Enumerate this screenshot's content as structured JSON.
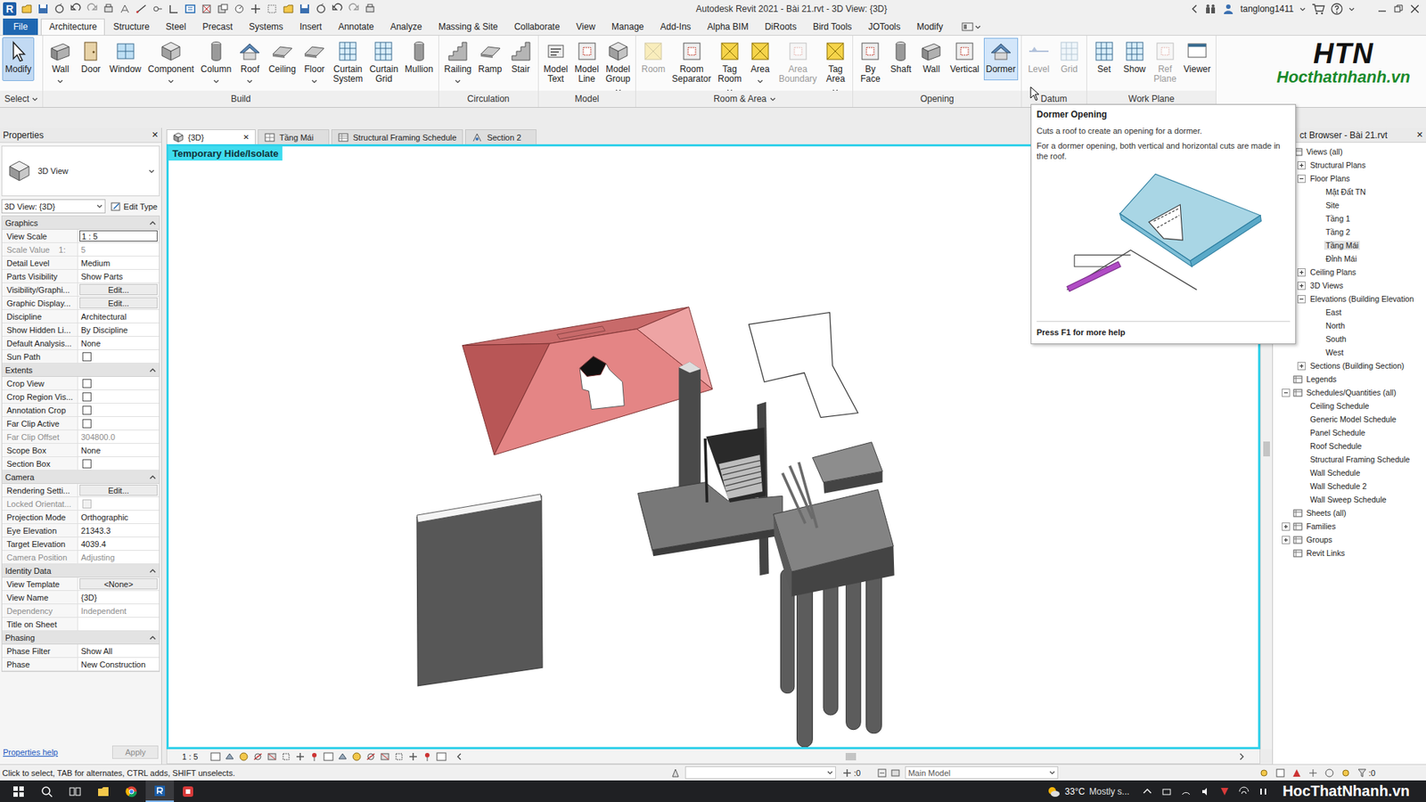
{
  "window": {
    "app_logo": "R",
    "title": "Autodesk Revit 2021 - Bài 21.rvt - 3D View: {3D}",
    "user": "tanglong1411"
  },
  "ribbon": {
    "tabs": [
      {
        "label": "File",
        "kind": "menu",
        "selected": false
      },
      {
        "label": "Architecture",
        "kind": "tab",
        "selected": true
      },
      {
        "label": "Structure",
        "kind": "tab",
        "selected": false
      },
      {
        "label": "Steel",
        "kind": "tab",
        "selected": false
      },
      {
        "label": "Precast",
        "kind": "tab",
        "selected": false
      },
      {
        "label": "Systems",
        "kind": "tab",
        "selected": false
      },
      {
        "label": "Insert",
        "kind": "tab",
        "selected": false
      },
      {
        "label": "Annotate",
        "kind": "tab",
        "selected": false
      },
      {
        "label": "Analyze",
        "kind": "tab",
        "selected": false
      },
      {
        "label": "Massing & Site",
        "kind": "tab",
        "selected": false
      },
      {
        "label": "Collaborate",
        "kind": "tab",
        "selected": false
      },
      {
        "label": "View",
        "kind": "tab",
        "selected": false
      },
      {
        "label": "Manage",
        "kind": "tab",
        "selected": false
      },
      {
        "label": "Add-Ins",
        "kind": "tab",
        "selected": false
      },
      {
        "label": "Alpha BIM",
        "kind": "tab",
        "selected": false
      },
      {
        "label": "DiRoots",
        "kind": "tab",
        "selected": false
      },
      {
        "label": "Bird Tools",
        "kind": "tab",
        "selected": false
      },
      {
        "label": "JOTools",
        "kind": "tab",
        "selected": false
      },
      {
        "label": "Modify",
        "kind": "tab",
        "selected": false
      }
    ],
    "panels": [
      {
        "title": "Select",
        "dropdown": true,
        "buttons": [
          {
            "label": "Modify",
            "selected": true,
            "hovered": false,
            "disabled": false,
            "dropdown": false
          }
        ]
      },
      {
        "title": "Build",
        "dropdown": false,
        "buttons": [
          {
            "label": "Wall",
            "selected": false,
            "hovered": false,
            "disabled": false,
            "dropdown": true
          },
          {
            "label": "Door",
            "selected": false,
            "hovered": false,
            "disabled": false,
            "dropdown": false
          },
          {
            "label": "Window",
            "selected": false,
            "hovered": false,
            "disabled": false,
            "dropdown": false
          },
          {
            "label": "Component",
            "selected": false,
            "hovered": false,
            "disabled": false,
            "dropdown": true
          },
          {
            "label": "Column",
            "selected": false,
            "hovered": false,
            "disabled": false,
            "dropdown": true
          },
          {
            "label": "Roof",
            "selected": false,
            "hovered": false,
            "disabled": false,
            "dropdown": true
          },
          {
            "label": "Ceiling",
            "selected": false,
            "hovered": false,
            "disabled": false,
            "dropdown": false
          },
          {
            "label": "Floor",
            "selected": false,
            "hovered": false,
            "disabled": false,
            "dropdown": true
          },
          {
            "label": "Curtain System",
            "selected": false,
            "hovered": false,
            "disabled": false,
            "dropdown": false
          },
          {
            "label": "Curtain Grid",
            "selected": false,
            "hovered": false,
            "disabled": false,
            "dropdown": false
          },
          {
            "label": "Mullion",
            "selected": false,
            "hovered": false,
            "disabled": false,
            "dropdown": false
          }
        ]
      },
      {
        "title": "Circulation",
        "dropdown": false,
        "buttons": [
          {
            "label": "Railing",
            "selected": false,
            "hovered": false,
            "disabled": false,
            "dropdown": true
          },
          {
            "label": "Ramp",
            "selected": false,
            "hovered": false,
            "disabled": false,
            "dropdown": false
          },
          {
            "label": "Stair",
            "selected": false,
            "hovered": false,
            "disabled": false,
            "dropdown": false
          }
        ]
      },
      {
        "title": "Model",
        "dropdown": false,
        "buttons": [
          {
            "label": "Model Text",
            "selected": false,
            "hovered": false,
            "disabled": false,
            "dropdown": false
          },
          {
            "label": "Model Line",
            "selected": false,
            "hovered": false,
            "disabled": false,
            "dropdown": false
          },
          {
            "label": "Model Group",
            "selected": false,
            "hovered": false,
            "disabled": false,
            "dropdown": true
          }
        ]
      },
      {
        "title": "Room & Area",
        "dropdown": true,
        "buttons": [
          {
            "label": "Room",
            "selected": false,
            "hovered": false,
            "disabled": true,
            "dropdown": false
          },
          {
            "label": "Room Separator",
            "selected": false,
            "hovered": false,
            "disabled": false,
            "dropdown": false
          },
          {
            "label": "Tag Room",
            "selected": false,
            "hovered": false,
            "disabled": false,
            "dropdown": true
          },
          {
            "label": "Area",
            "selected": false,
            "hovered": false,
            "disabled": false,
            "dropdown": true
          },
          {
            "label": "Area Boundary",
            "selected": false,
            "hovered": false,
            "disabled": true,
            "dropdown": false
          },
          {
            "label": "Tag Area",
            "selected": false,
            "hovered": false,
            "disabled": false,
            "dropdown": true
          }
        ]
      },
      {
        "title": "Opening",
        "dropdown": false,
        "buttons": [
          {
            "label": "By Face",
            "selected": false,
            "hovered": false,
            "disabled": false,
            "dropdown": false
          },
          {
            "label": "Shaft",
            "selected": false,
            "hovered": false,
            "disabled": false,
            "dropdown": false
          },
          {
            "label": "Wall",
            "selected": false,
            "hovered": false,
            "disabled": false,
            "dropdown": false
          },
          {
            "label": "Vertical",
            "selected": false,
            "hovered": false,
            "disabled": false,
            "dropdown": false
          },
          {
            "label": "Dormer",
            "selected": false,
            "hovered": true,
            "disabled": false,
            "dropdown": false
          }
        ]
      },
      {
        "title": "Datum",
        "dropdown": false,
        "buttons": [
          {
            "label": "Level",
            "selected": false,
            "hovered": false,
            "disabled": true,
            "dropdown": false
          },
          {
            "label": "Grid",
            "selected": false,
            "hovered": false,
            "disabled": true,
            "dropdown": false
          }
        ]
      },
      {
        "title": "Work Plane",
        "dropdown": false,
        "buttons": [
          {
            "label": "Set",
            "selected": false,
            "hovered": false,
            "disabled": false,
            "dropdown": false
          },
          {
            "label": "Show",
            "selected": false,
            "hovered": false,
            "disabled": false,
            "dropdown": false
          },
          {
            "label": "Ref Plane",
            "selected": false,
            "hovered": false,
            "disabled": true,
            "dropdown": false
          },
          {
            "label": "Viewer",
            "selected": false,
            "hovered": false,
            "disabled": false,
            "dropdown": false
          }
        ]
      }
    ]
  },
  "logo": {
    "mark": "HTN",
    "site": "Hocthatnhanh.vn"
  },
  "tooltip": {
    "title": "Dormer Opening",
    "lines": [
      "Cuts a roof to create an opening for a dormer.",
      "For a dormer opening, both vertical and horizontal cuts are made in the roof."
    ],
    "footer": "Press F1 for more help"
  },
  "properties": {
    "title": "Properties",
    "close": "✕",
    "type": "3D View",
    "selector": "3D View: {3D}",
    "edit_type": "Edit Type",
    "sections": [
      {
        "title": "Graphics",
        "expanded": true,
        "rows": [
          {
            "label": "View Scale",
            "value": "1 : 5",
            "kind": "field",
            "disabled": false
          },
          {
            "label": "Scale Value    1:",
            "value": "5",
            "kind": "text",
            "disabled": true
          },
          {
            "label": "Detail Level",
            "value": "Medium",
            "kind": "text",
            "disabled": false
          },
          {
            "label": "Parts Visibility",
            "value": "Show Parts",
            "kind": "text",
            "disabled": false
          },
          {
            "label": "Visibility/Graphi...",
            "value": "Edit...",
            "kind": "button",
            "disabled": false
          },
          {
            "label": "Graphic Display...",
            "value": "Edit...",
            "kind": "button",
            "disabled": false
          },
          {
            "label": "Discipline",
            "value": "Architectural",
            "kind": "text",
            "disabled": false
          },
          {
            "label": "Show Hidden Li...",
            "value": "By Discipline",
            "kind": "text",
            "disabled": false
          },
          {
            "label": "Default Analysis...",
            "value": "None",
            "kind": "text",
            "disabled": false
          },
          {
            "label": "Sun Path",
            "kind": "checkbox",
            "checked": false,
            "disabled": false
          }
        ]
      },
      {
        "title": "Extents",
        "expanded": true,
        "rows": [
          {
            "label": "Crop View",
            "kind": "checkbox",
            "checked": false,
            "disabled": false
          },
          {
            "label": "Crop Region Vis...",
            "kind": "checkbox",
            "checked": false,
            "disabled": false
          },
          {
            "label": "Annotation Crop",
            "kind": "checkbox",
            "checked": false,
            "disabled": false
          },
          {
            "label": "Far Clip Active",
            "kind": "checkbox",
            "checked": false,
            "disabled": false
          },
          {
            "label": "Far Clip Offset",
            "value": "304800.0",
            "kind": "text",
            "disabled": true
          },
          {
            "label": "Scope Box",
            "value": "None",
            "kind": "text",
            "disabled": false
          },
          {
            "label": "Section Box",
            "kind": "checkbox",
            "checked": false,
            "disabled": false
          }
        ]
      },
      {
        "title": "Camera",
        "expanded": true,
        "rows": [
          {
            "label": "Rendering Setti...",
            "value": "Edit...",
            "kind": "button",
            "disabled": false
          },
          {
            "label": "Locked Orientat...",
            "kind": "checkbox",
            "checked": false,
            "disabled": true
          },
          {
            "label": "Projection Mode",
            "value": "Orthographic",
            "kind": "text",
            "disabled": false
          },
          {
            "label": "Eye Elevation",
            "value": "21343.3",
            "kind": "text",
            "disabled": false
          },
          {
            "label": "Target Elevation",
            "value": "4039.4",
            "kind": "text",
            "disabled": false
          },
          {
            "label": "Camera Position",
            "value": "Adjusting",
            "kind": "text",
            "disabled": true
          }
        ]
      },
      {
        "title": "Identity Data",
        "expanded": true,
        "rows": [
          {
            "label": "View Template",
            "value": "<None>",
            "kind": "button",
            "disabled": false
          },
          {
            "label": "View Name",
            "value": "{3D}",
            "kind": "text",
            "disabled": false
          },
          {
            "label": "Dependency",
            "value": "Independent",
            "kind": "text",
            "disabled": true
          },
          {
            "label": "Title on Sheet",
            "value": "",
            "kind": "text",
            "disabled": false
          }
        ]
      },
      {
        "title": "Phasing",
        "expanded": true,
        "rows": [
          {
            "label": "Phase Filter",
            "value": "Show All",
            "kind": "text",
            "disabled": false
          },
          {
            "label": "Phase",
            "value": "New Construction",
            "kind": "text",
            "disabled": false
          }
        ]
      }
    ],
    "help": "Properties help",
    "apply": "Apply"
  },
  "view_tabs": [
    {
      "label": "{3D}",
      "selected": true,
      "close": "✕"
    },
    {
      "label": "Tầng Mái",
      "selected": false
    },
    {
      "label": "Structural Framing Schedule",
      "selected": false
    },
    {
      "label": "Section 2",
      "selected": false
    }
  ],
  "view": {
    "banner": "Temporary Hide/Isolate",
    "scale": "1 : 5"
  },
  "browser": {
    "title": "ct Browser - Bài 21.rvt",
    "close": "✕",
    "items": [
      {
        "label": "Views (all)",
        "depth": 0,
        "expanded": true,
        "selected": false
      },
      {
        "label": "Structural Plans",
        "depth": 1,
        "expanded": false,
        "selected": false
      },
      {
        "label": "Floor Plans",
        "depth": 1,
        "expanded": true,
        "selected": false
      },
      {
        "label": "Mặt Đất TN",
        "depth": 2,
        "selected": false
      },
      {
        "label": "Site",
        "depth": 2,
        "selected": false
      },
      {
        "label": "Tầng 1",
        "depth": 2,
        "selected": false
      },
      {
        "label": "Tầng 2",
        "depth": 2,
        "selected": false
      },
      {
        "label": "Tầng Mái",
        "depth": 2,
        "selected": true
      },
      {
        "label": "Đỉnh Mái",
        "depth": 2,
        "selected": false
      },
      {
        "label": "Ceiling Plans",
        "depth": 1,
        "expanded": false,
        "selected": false
      },
      {
        "label": "3D Views",
        "depth": 1,
        "expanded": false,
        "selected": false
      },
      {
        "label": "Elevations (Building Elevation",
        "depth": 1,
        "expanded": true,
        "selected": false
      },
      {
        "label": "East",
        "depth": 2,
        "selected": false
      },
      {
        "label": "North",
        "depth": 2,
        "selected": false
      },
      {
        "label": "South",
        "depth": 2,
        "selected": false
      },
      {
        "label": "West",
        "depth": 2,
        "selected": false
      },
      {
        "label": "Sections (Building Section)",
        "depth": 1,
        "expanded": false,
        "selected": false
      },
      {
        "label": "Legends",
        "depth": 0,
        "selected": false
      },
      {
        "label": "Schedules/Quantities (all)",
        "depth": 0,
        "expanded": true,
        "selected": false
      },
      {
        "label": "Ceiling Schedule",
        "depth": 1,
        "selected": false
      },
      {
        "label": "Generic Model Schedule",
        "depth": 1,
        "selected": false
      },
      {
        "label": "Panel Schedule",
        "depth": 1,
        "selected": false
      },
      {
        "label": "Roof Schedule",
        "depth": 1,
        "selected": false
      },
      {
        "label": "Structural Framing Schedule",
        "depth": 1,
        "selected": false
      },
      {
        "label": "Wall Schedule",
        "depth": 1,
        "selected": false
      },
      {
        "label": "Wall Schedule 2",
        "depth": 1,
        "selected": false
      },
      {
        "label": "Wall Sweep Schedule",
        "depth": 1,
        "selected": false
      },
      {
        "label": "Sheets (all)",
        "depth": 0,
        "selected": false
      },
      {
        "label": "Families",
        "depth": 0,
        "expanded": false,
        "selected": false
      },
      {
        "label": "Groups",
        "depth": 0,
        "expanded": false,
        "selected": false
      },
      {
        "label": "Revit Links",
        "depth": 0,
        "selected": false
      }
    ]
  },
  "status_bar": {
    "message": "Click to select, TAB for alternates, CTRL adds, SHIFT unselects.",
    "selection_count": ":0",
    "model": "Main Model",
    "filter_count": ":0"
  },
  "taskbar": {
    "temperature": "33°C",
    "weather": "Mostly s...",
    "watermark": "HocThatNhanh.vn"
  }
}
